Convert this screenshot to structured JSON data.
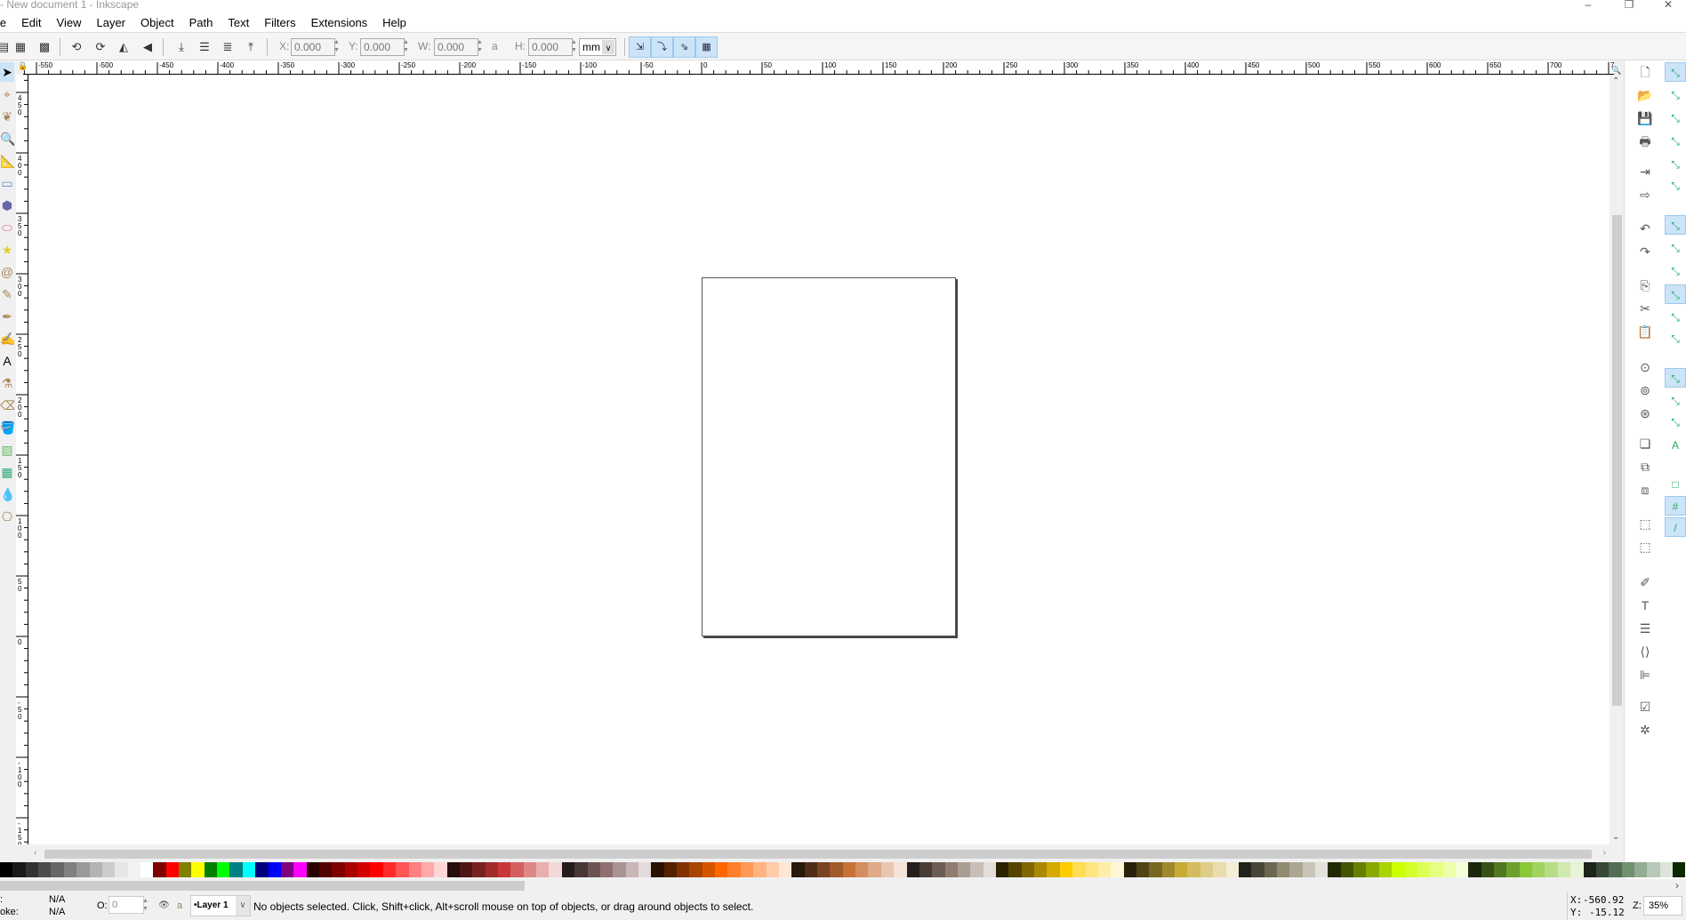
{
  "window": {
    "title": "- New document 1 - Inkscape",
    "controls": [
      "minimize",
      "maximize",
      "close"
    ]
  },
  "menu": [
    "le",
    "Edit",
    "View",
    "Layer",
    "Object",
    "Path",
    "Text",
    "Filters",
    "Extensions",
    "Help"
  ],
  "toolbar": {
    "x_label": "X:",
    "x_value": "0.000",
    "y_label": "Y:",
    "y_value": "0.000",
    "w_label": "W:",
    "w_value": "0.000",
    "h_label": "H:",
    "h_value": "0.000",
    "unit": "mm",
    "lock_icon": "lock-icon"
  },
  "rulers": {
    "horizontal_labels": [
      -550,
      -500,
      -450,
      -400,
      -350,
      -300,
      -250,
      -200,
      -150,
      -100,
      -50,
      0,
      50,
      100,
      150,
      200,
      250,
      300,
      350,
      400,
      450,
      500,
      550,
      600,
      650,
      700,
      750
    ],
    "vertical_labels": [
      450,
      400,
      350,
      300,
      250,
      200,
      150,
      100,
      50,
      0,
      -50,
      -100,
      -150
    ],
    "unit": "mm"
  },
  "page": {
    "width_mm": 210,
    "height_mm": 297
  },
  "tools": [
    "selector",
    "node",
    "tweak",
    "zoom",
    "measure",
    "rectangle",
    "3d-box",
    "ellipse",
    "star",
    "spiral",
    "pencil",
    "pen",
    "calligraphy",
    "text",
    "spray",
    "eraser",
    "bucket",
    "gradient",
    "mesh",
    "dropper",
    "connector"
  ],
  "palette": [
    "#000000",
    "#1a1a1a",
    "#333333",
    "#4d4d4d",
    "#666666",
    "#808080",
    "#999999",
    "#b3b3b3",
    "#cccccc",
    "#e6e6e6",
    "#f2f2f2",
    "#ffffff",
    "#800000",
    "#ff0000",
    "#808000",
    "#ffff00",
    "#008000",
    "#00ff00",
    "#008080",
    "#00ffff",
    "#000080",
    "#0000ff",
    "#800080",
    "#ff00ff",
    "#2b0000",
    "#550000",
    "#800000",
    "#aa0000",
    "#d40000",
    "#ff0000",
    "#ff2a2a",
    "#ff5555",
    "#ff8080",
    "#ffaaaa",
    "#ffd5d5",
    "#280b0b",
    "#501616",
    "#782121",
    "#a02c2c",
    "#c83737",
    "#d35f5f",
    "#de8787",
    "#e9afaf",
    "#f4d7d7",
    "#241c1c",
    "#483737",
    "#6c5353",
    "#916f6f",
    "#ac9393",
    "#c8b7b7",
    "#e3dbdb",
    "#2b1100",
    "#552200",
    "#803300",
    "#aa4400",
    "#d45500",
    "#ff6600",
    "#ff7f2a",
    "#ff9955",
    "#ffb380",
    "#ffccaa",
    "#ffe6d5",
    "#28170b",
    "#502d16",
    "#784421",
    "#a05a2c",
    "#c87137",
    "#d38d5f",
    "#deaa87",
    "#e9c6af",
    "#f4e3d7",
    "#241f1c",
    "#483e37",
    "#6c5d53",
    "#917c6f",
    "#ac9d93",
    "#c8beb7",
    "#e3dedb",
    "#2b2200",
    "#554400",
    "#806600",
    "#aa8800",
    "#d4aa00",
    "#ffcc00",
    "#ffdd55",
    "#ffe680",
    "#ffeeaa",
    "#fff6d5",
    "#28220b",
    "#504416",
    "#786721",
    "#a0892c",
    "#c8ab37",
    "#d3bc5f",
    "#decd87",
    "#e9ddaf",
    "#f4eed7",
    "#24221c",
    "#484537",
    "#6c6753",
    "#918a6f",
    "#aca793",
    "#c8c4b7",
    "#e3e2db",
    "#222b00",
    "#445500",
    "#668000",
    "#88aa00",
    "#aad400",
    "#ccff00",
    "#d4ff2a",
    "#ddff55",
    "#e5ff80",
    "#eeffaa",
    "#f6ffd5",
    "#1c280b",
    "#375016",
    "#527821",
    "#6ea02c",
    "#89c837",
    "#a0d35f",
    "#b7de87",
    "#cfe9af",
    "#e7f4d7",
    "#1c241c",
    "#374837",
    "#536c53",
    "#6f916f",
    "#93ac93",
    "#b7c8b7",
    "#dbe3db",
    "#0b2800"
  ],
  "status": {
    "fill_label": ":",
    "fill_value": "N/A",
    "stroke_label": "oke:",
    "stroke_value": "N/A",
    "opacity_label": "O:",
    "opacity_value": "0",
    "layer": "•Layer 1",
    "message": "No objects selected. Click, Shift+click, Alt+scroll mouse on top of objects, or drag around objects to select.",
    "cursor_x_label": "X:",
    "cursor_x": "-560.92",
    "cursor_y_label": "Y:",
    "cursor_y": "-15.12",
    "zoom_label": "Z:",
    "zoom": "35%"
  }
}
